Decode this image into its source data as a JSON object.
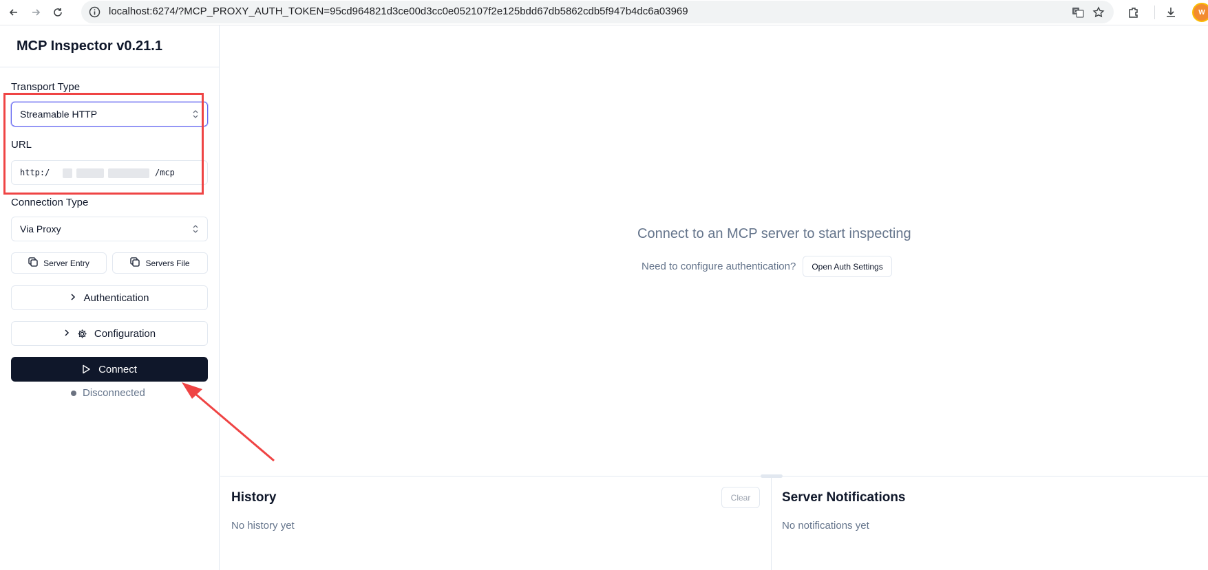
{
  "browser": {
    "url": "localhost:6274/?MCP_PROXY_AUTH_TOKEN=95cd964821d3ce00d3cc0e052107f2e125bdd67db5862cdb5f947b4dc6a03969",
    "icons": [
      "back-icon",
      "forward-icon",
      "reload-icon",
      "site-info-icon",
      "translate-icon",
      "bookmark-star-icon",
      "extensions-icon",
      "download-icon",
      "profile-avatar"
    ]
  },
  "sidebar": {
    "title": "MCP Inspector v0.21.1",
    "transport_label": "Transport Type",
    "transport_value": "Streamable HTTP",
    "url_label": "URL",
    "url_prefix": "http:/",
    "url_suffix": "/mcp",
    "connection_label": "Connection Type",
    "connection_value": "Via Proxy",
    "server_entry_label": "Server Entry",
    "servers_file_label": "Servers File",
    "authentication_label": "Authentication",
    "configuration_label": "Configuration",
    "connect_label": "Connect",
    "status_text": "Disconnected"
  },
  "main": {
    "empty_title": "Connect to an MCP server to start inspecting",
    "auth_prompt": "Need to configure authentication?",
    "auth_button": "Open Auth Settings"
  },
  "history": {
    "title": "History",
    "clear_label": "Clear",
    "empty_text": "No history yet"
  },
  "notifications": {
    "title": "Server Notifications",
    "empty_text": "No notifications yet"
  },
  "colors": {
    "primary": "#0f172a",
    "muted_text": "#64748b",
    "border": "#e2e8f0",
    "annotation": "#ef4444",
    "focus": "#6366f1"
  }
}
